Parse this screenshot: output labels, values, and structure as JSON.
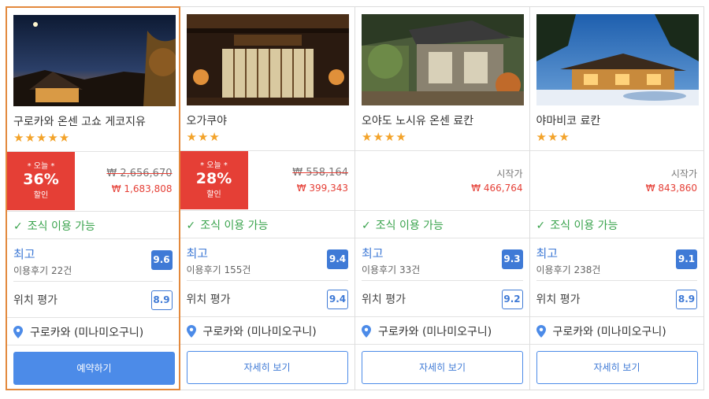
{
  "colors": {
    "accent": "#4c8be8",
    "deal": "#e53f36",
    "star": "#f3a32a",
    "breakfast": "#3aa34d",
    "selected_border": "#e3893d"
  },
  "hotels": [
    {
      "name": "구로카와 온센 고쇼 게코지유",
      "stars": "★★★★★",
      "deal_today": "* 오늘 *",
      "deal_pct": "36%",
      "deal_sale": "할인",
      "original_price": "₩ 2,656,670",
      "price": "₩ 1,683,808",
      "breakfast": "조식 이용 가능",
      "rating_label": "최고",
      "reviews": "이용후기 22건",
      "score": "9.6",
      "location_label": "위치 평가",
      "location_score": "8.9",
      "area": "구로카와 (미나미오구니)",
      "button": "예약하기"
    },
    {
      "name": "오가쿠야",
      "stars": "★★★",
      "deal_today": "* 오늘 *",
      "deal_pct": "28%",
      "deal_sale": "할인",
      "original_price": "₩ 558,164",
      "price": "₩ 399,343",
      "breakfast": "조식 이용 가능",
      "rating_label": "최고",
      "reviews": "이용후기 155건",
      "score": "9.4",
      "location_label": "위치 평가",
      "location_score": "9.4",
      "area": "구로카와 (미나미오구니)",
      "button": "자세히 보기"
    },
    {
      "name": "오야도 노시유 온센 료칸",
      "stars": "★★★★",
      "from_label": "시작가",
      "price": "₩ 466,764",
      "breakfast": "조식 이용 가능",
      "rating_label": "최고",
      "reviews": "이용후기 33건",
      "score": "9.3",
      "location_label": "위치 평가",
      "location_score": "9.2",
      "area": "구로카와 (미나미오구니)",
      "button": "자세히 보기"
    },
    {
      "name": "야마비코 료칸",
      "stars": "★★★",
      "from_label": "시작가",
      "price": "₩ 843,860",
      "breakfast": "조식 이용 가능",
      "rating_label": "최고",
      "reviews": "이용후기 238건",
      "score": "9.1",
      "location_label": "위치 평가",
      "location_score": "8.9",
      "area": "구로카와 (미나미오구니)",
      "button": "자세히 보기"
    }
  ]
}
